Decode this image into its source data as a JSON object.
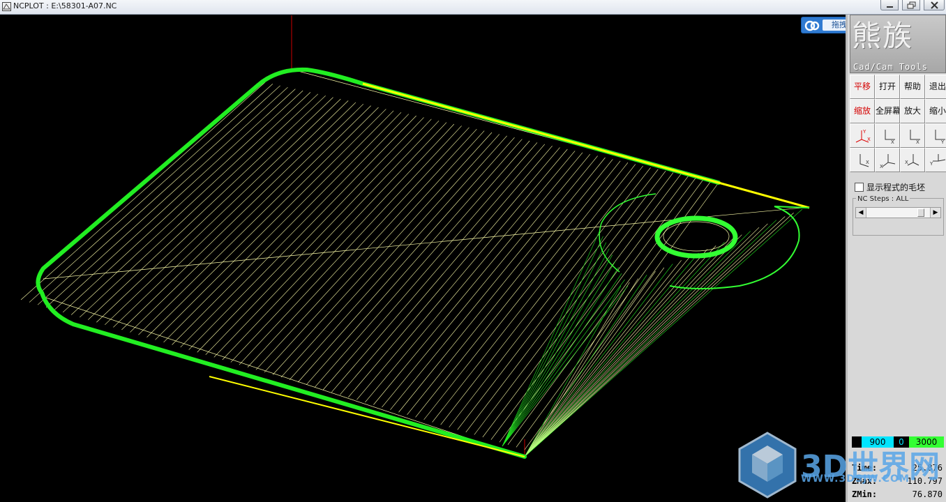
{
  "window": {
    "title": "NCPLOT : E:\\58301-A07.NC"
  },
  "upload_badge": {
    "label": "拖拽上传"
  },
  "panel": {
    "logo_chars": "熊族",
    "logo_sub": "Cad/Cam Tools",
    "toolbar_row1": [
      "平移",
      "打开",
      "帮助",
      "退出"
    ],
    "toolbar_row2": [
      "缩放",
      "全屏幕",
      "放大",
      "缩小"
    ],
    "view_icons": [
      "view-iso-xyz-icon",
      "view-front-icon",
      "view-side-icon",
      "view-top-icon",
      "view-iso-2-icon",
      "view-iso-3-icon",
      "view-iso-4-icon",
      "view-iso-5-icon"
    ],
    "show_stock_label": "显示程式的毛坯",
    "nc_steps_label": "NC Steps : ALL",
    "colorbar": {
      "cyan_value": "900",
      "black_value": "0",
      "green_value": "3000",
      "cyan_color": "#00e5ff",
      "green_color": "#33ff33"
    },
    "stats": [
      {
        "key": "Time:",
        "value": "25.876"
      },
      {
        "key": "ZMax:",
        "value": "110.797"
      },
      {
        "key": "ZMin:",
        "value": "76.870"
      }
    ]
  },
  "viewport": {
    "toolpath_color_cut": "#ffffaa",
    "toolpath_color_contour": "#22ee22",
    "toolpath_color_edge": "#ffff00",
    "axis_color": "#cc0000"
  },
  "watermark": {
    "text": "3D世界网",
    "url": "WWW.3DSJW.COM"
  }
}
